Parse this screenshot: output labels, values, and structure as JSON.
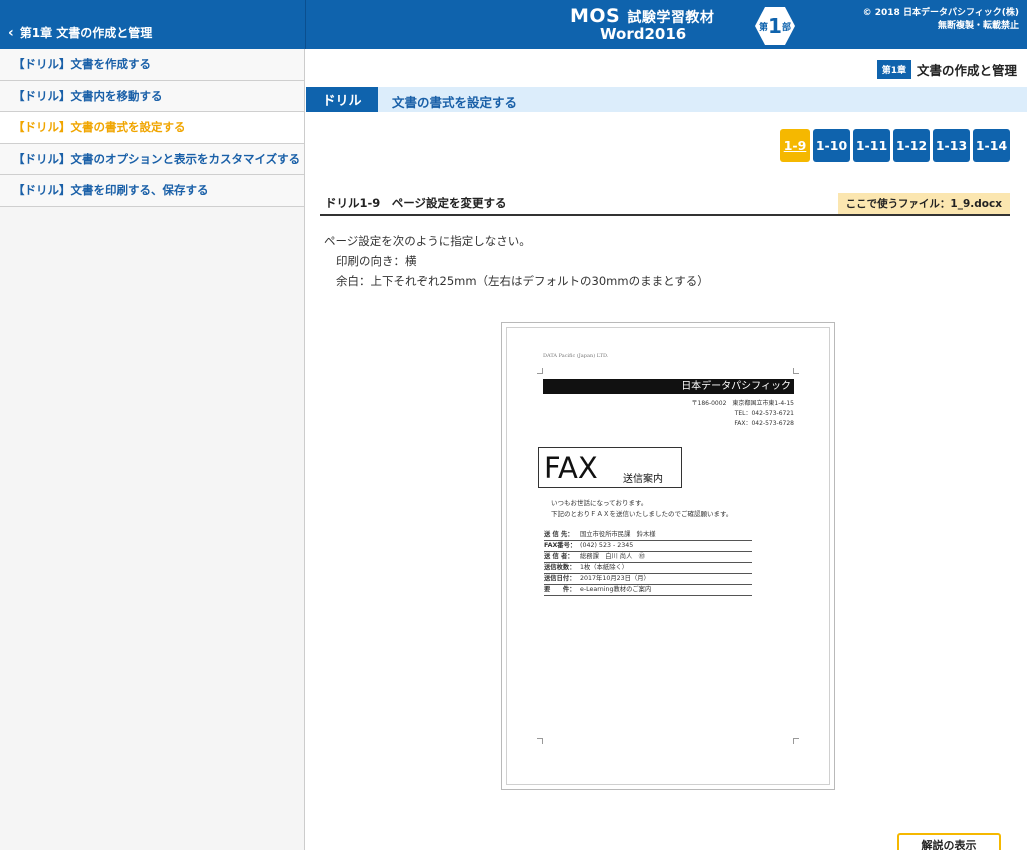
{
  "header": {
    "back_label": "第1章 文書の作成と管理",
    "logo_main": "MOS",
    "logo_main_rest": "試験学習教材",
    "logo_sub": "Word2016",
    "logo_badge_small": "第",
    "logo_badge_big": "1",
    "logo_badge_suffix": "部",
    "copyright_line1": "© 2018 日本データパシフィック(株)",
    "copyright_line2": "無断複製・転載禁止"
  },
  "sidebar": {
    "items": [
      {
        "label": "【ドリル】文書を作成する"
      },
      {
        "label": "【ドリル】文書内を移動する"
      },
      {
        "label": "【ドリル】文書の書式を設定する"
      },
      {
        "label": "【ドリル】文書のオプションと表示をカスタマイズする"
      },
      {
        "label": "【ドリル】文書を印刷する、保存する"
      }
    ],
    "active_index": 2
  },
  "main": {
    "chapter_tag": "第1章",
    "chapter_title": "文書の作成と管理",
    "drill_tag": "ドリル",
    "drill_title": "文書の書式を設定する",
    "pages": [
      "1-9",
      "1-10",
      "1-11",
      "1-12",
      "1-13",
      "1-14"
    ],
    "active_page": "1-9",
    "question_title": "ドリル1-9　ページ設定を変更する",
    "file_label": "ここで使うファイル：1_9.docx",
    "instructions": [
      "ページ設定を次のように指定しなさい。",
      "印刷の向き：横",
      "余白：上下それぞれ25mm（左右はデフォルトの30mmのままとする）"
    ],
    "explain_button": "解説の表示"
  },
  "document_preview": {
    "company_en": "DATA Pacific (Japan) LTD.",
    "company_jp": "日本データパシフィック",
    "address_line1": "〒186-0002　東京都国立市東1-4-15",
    "address_line2": "TEL：042-573-6721",
    "address_line3": "FAX：042-573-6728",
    "fax_title": "FAX",
    "fax_subtitle": "送信案内",
    "greeting1": "いつもお世話になっております。",
    "greeting2": "下記のとおりＦＡＸを送信いたしましたのでご確認願います。",
    "fields": [
      {
        "key": "送 信 先：",
        "value": "国立市役所市民課　鈴木様"
      },
      {
        "key": "FAX番号：",
        "value": "(042) 523 - 2345"
      },
      {
        "key": "送 信 者：",
        "value": "総務課　白川 尚人　㊞"
      },
      {
        "key": "送信枚数：",
        "value": "1枚（本紙除く）"
      },
      {
        "key": "送信日付：",
        "value": "2017年10月23日（月）"
      },
      {
        "key": "要　　件：",
        "value": "e-Learning教材のご案内"
      }
    ]
  }
}
